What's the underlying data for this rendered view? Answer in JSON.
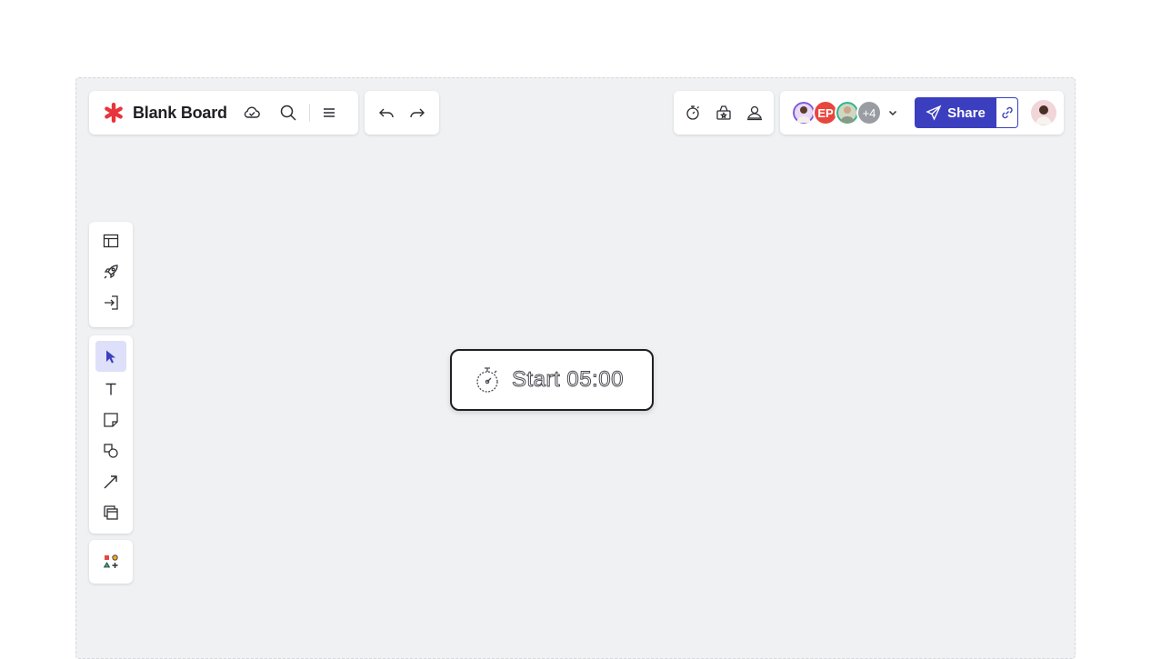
{
  "board": {
    "title": "Blank Board"
  },
  "collab": {
    "avatar_initials": "EP",
    "extra_count": "+4",
    "share_label": "Share"
  },
  "timer": {
    "label": "Start 05:00"
  },
  "colors": {
    "accent": "#3b3fbf",
    "logo": "#e8343c",
    "canvas": "#f0f1f3"
  },
  "icons": {
    "header": [
      "cloud-check-icon",
      "search-icon",
      "menu-icon",
      "undo-icon",
      "redo-icon"
    ],
    "tools_top": [
      "timer-icon",
      "voting-icon",
      "attention-icon"
    ],
    "sidebar_top": [
      "templates-icon",
      "rocket-icon",
      "import-icon"
    ],
    "sidebar_tools": [
      "select-icon",
      "text-icon",
      "sticky-note-icon",
      "shapes-icon",
      "line-icon",
      "frame-icon"
    ],
    "sidebar_bottom": [
      "add-apps-icon"
    ]
  }
}
